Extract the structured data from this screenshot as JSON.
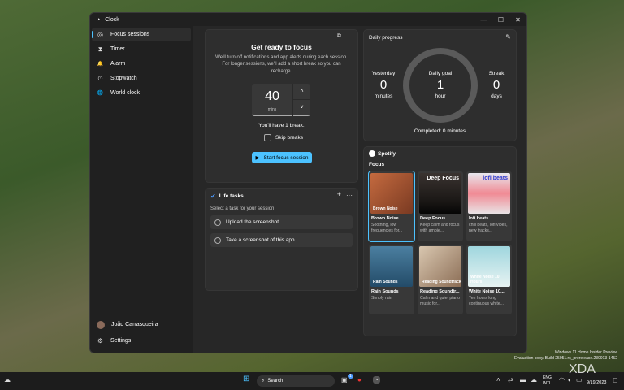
{
  "window": {
    "title": "Clock",
    "controls": [
      "—",
      "☐",
      "✕"
    ]
  },
  "sidebar": {
    "items": [
      {
        "label": "Focus sessions",
        "icon": "focus-icon",
        "glyph": "◎"
      },
      {
        "label": "Timer",
        "icon": "hourglass-icon",
        "glyph": "⧗"
      },
      {
        "label": "Alarm",
        "icon": "bell-icon",
        "glyph": "🔔"
      },
      {
        "label": "Stopwatch",
        "icon": "stopwatch-icon",
        "glyph": "⏱"
      },
      {
        "label": "World clock",
        "icon": "globe-icon",
        "glyph": "🌐"
      }
    ],
    "user": "João Carrasqueira",
    "settings": "Settings"
  },
  "focus": {
    "title": "Get ready to focus",
    "desc": "We'll turn off notifications and app alerts during each session. For longer sessions, we'll add a short break so you can recharge.",
    "minutes": "40",
    "unit": "mins",
    "breaks": "You'll have 1 break.",
    "skip": "Skip breaks",
    "start": "Start focus session"
  },
  "progress": {
    "title": "Daily progress",
    "yesterday_label": "Yesterday",
    "yesterday": "0",
    "yesterday_unit": "minutes",
    "goal_label": "Daily goal",
    "goal": "1",
    "goal_unit": "hour",
    "streak_label": "Streak",
    "streak": "0",
    "streak_unit": "days",
    "completed": "Completed: 0 minutes"
  },
  "tasks": {
    "title": "Life tasks",
    "prompt": "Select a task for your session",
    "items": [
      "Upload the screenshot",
      "Take a screenshot of this app"
    ]
  },
  "spotify": {
    "brand": "Spotify",
    "section": "Focus",
    "playlists": [
      {
        "title": "Brown Noise",
        "desc": "Soothing, low frequencies for...",
        "art": "Brown Noise",
        "bg": "linear-gradient(135deg,#c46a3f,#7a3a22)"
      },
      {
        "title": "Deep Focus",
        "desc": "Keep calm and focus with ambie...",
        "art": "Deep Focus",
        "bg": "linear-gradient(180deg,#3a3330,#1a1715 70%,#050505)"
      },
      {
        "title": "lofi beats",
        "desc": "chill beats, lofi vibes, new tracks...",
        "art": "lofi beats",
        "bg": "linear-gradient(180deg,#e8e8ee,#f08a94 50%,#e9e4e6)"
      },
      {
        "title": "Rain Sounds",
        "desc": "Simply rain",
        "art": "Rain Sounds",
        "bg": "linear-gradient(180deg,#4b7fa0,#234b68)"
      },
      {
        "title": "Reading Soundtr...",
        "desc": "Calm and quiet piano music for...",
        "art": "Reading Soundtrack",
        "bg": "linear-gradient(135deg,#d9c7b0,#8b6d55)"
      },
      {
        "title": "White Noise 10...",
        "desc": "Ten hours long continuous white...",
        "art": "White Noise 10 Hours",
        "bg": "linear-gradient(180deg,#9fd6de,#e7f3f2)"
      }
    ]
  },
  "taskbar": {
    "search": "Search",
    "lang1": "ENG",
    "lang2": "INTL",
    "date": "9/19/2023",
    "badge": "1"
  },
  "watermark": {
    "line1": "Windows 11 Home Insider Preview",
    "line2": "Evaluation copy. Build 25951.rs_prerelease.230913-1452",
    "brand": "XDA"
  }
}
